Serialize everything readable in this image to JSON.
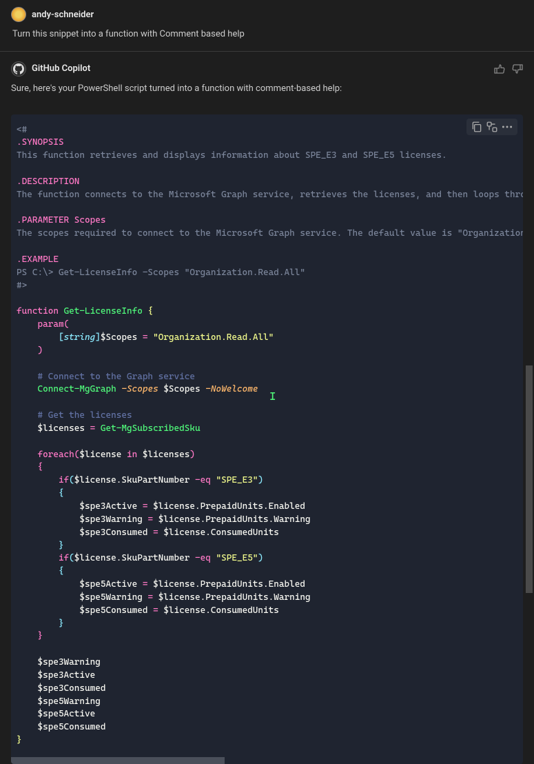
{
  "user": {
    "name": "andy-schneider",
    "message": "Turn this snippet into a function with Comment based help"
  },
  "copilot": {
    "name": "GitHub Copilot",
    "response": "Sure, here's your PowerShell script turned into a function with comment-based help:"
  },
  "code": {
    "comment_open": "<#",
    "synopsis_label": ".SYNOPSIS",
    "synopsis_text": "This function retrieves and displays information about SPE_E3 and SPE_E5 licenses.",
    "description_label": ".DESCRIPTION",
    "description_text": "The function connects to the Microsoft Graph service, retrieves the licenses, and then loops throu",
    "parameter_label": ".PARAMETER Scopes",
    "parameter_text": "The scopes required to connect to the Microsoft Graph service. The default value is \"Organization.",
    "example_label": ".EXAMPLE",
    "example_text": "PS C:\\> Get-LicenseInfo -Scopes \"Organization.Read.All\"",
    "comment_close": "#>",
    "kw_function": "function",
    "func_name": "Get-LicenseInfo",
    "kw_param": "param",
    "type_string": "string",
    "var_scopes": "$Scopes",
    "str_org": "\"Organization.Read.All\"",
    "comment_connect": "# Connect to the Graph service",
    "cmd_connect": "Connect-MgGraph",
    "param_scopes": "-Scopes",
    "param_nowelcome": "-NoWelcome",
    "comment_get": "# Get the licenses",
    "var_licenses": "$licenses",
    "cmd_getsku": "Get-MgSubscribedSku",
    "kw_foreach": "foreach",
    "var_license": "$license",
    "kw_in": "in",
    "kw_if": "if",
    "prop_sku": ".SkuPartNumber",
    "op_eq": "-eq",
    "str_spe3": "\"SPE_E3\"",
    "str_spe5": "\"SPE_E5\"",
    "var_spe3active": "$spe3Active",
    "var_spe3warning": "$spe3Warning",
    "var_spe3consumed": "$spe3Consumed",
    "var_spe5active": "$spe5Active",
    "var_spe5warning": "$spe5Warning",
    "var_spe5consumed": "$spe5Consumed",
    "prop_prepaid_enabled": ".PrepaidUnits.Enabled",
    "prop_prepaid_warning": ".PrepaidUnits.Warning",
    "prop_consumed": ".ConsumedUnits",
    "eq": " = "
  }
}
